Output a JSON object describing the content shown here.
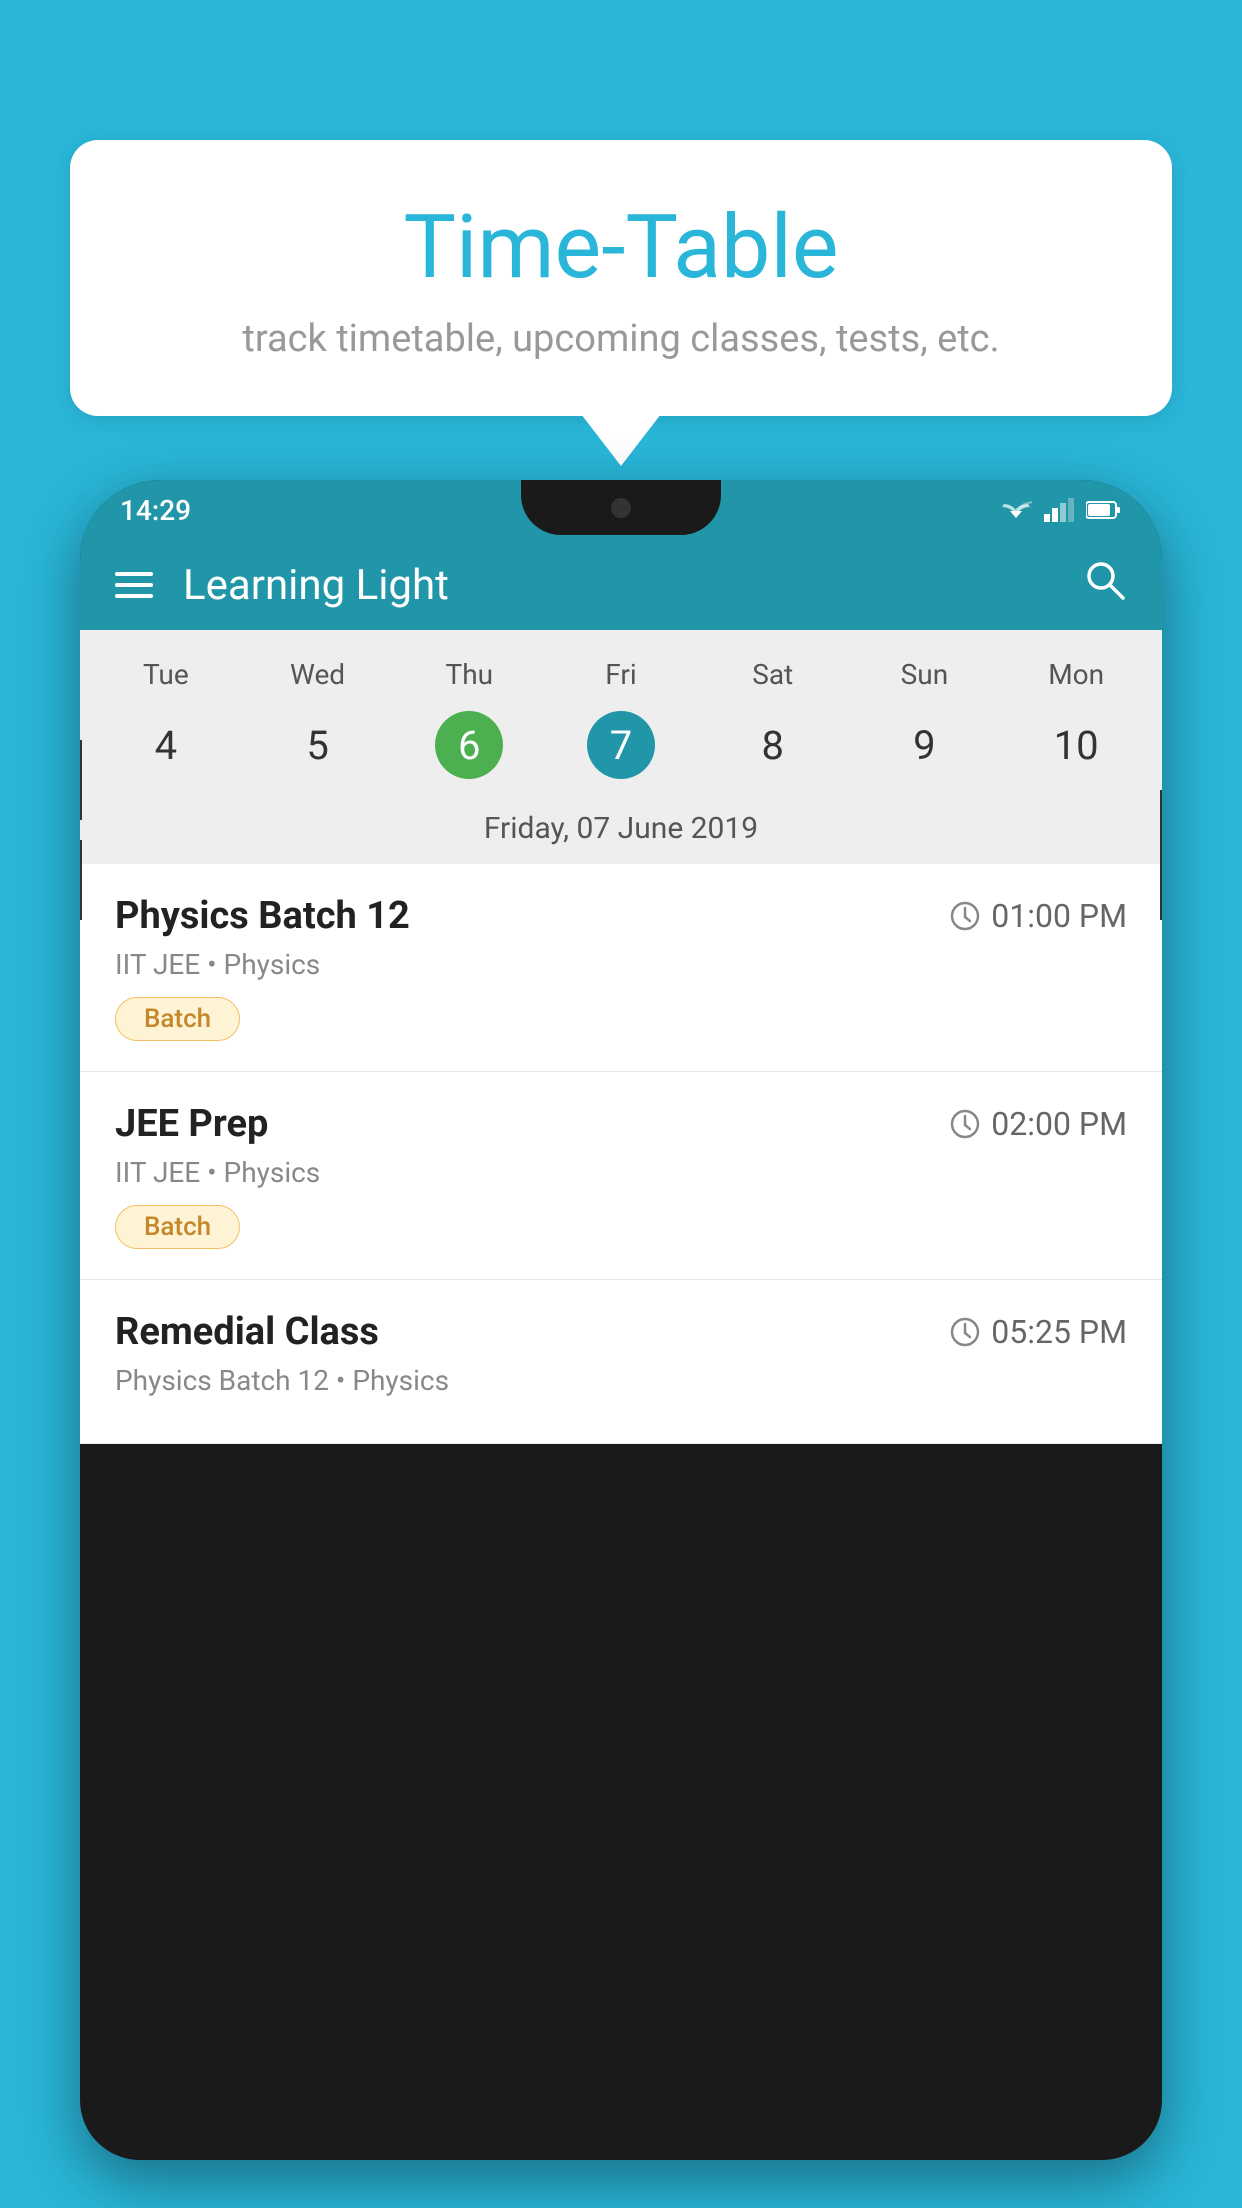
{
  "background_color": "#29b6d8",
  "bubble": {
    "title": "Time-Table",
    "subtitle": "track timetable, upcoming classes, tests, etc."
  },
  "phone": {
    "status_bar": {
      "time": "14:29"
    },
    "app_header": {
      "title": "Learning Light"
    },
    "calendar": {
      "days": [
        "Tue",
        "Wed",
        "Thu",
        "Fri",
        "Sat",
        "Sun",
        "Mon"
      ],
      "dates": [
        "4",
        "5",
        "6",
        "7",
        "8",
        "9",
        "10"
      ],
      "today_index": 2,
      "selected_index": 3,
      "selected_date_label": "Friday, 07 June 2019"
    },
    "classes": [
      {
        "name": "Physics Batch 12",
        "time": "01:00 PM",
        "meta": "IIT JEE • Physics",
        "badge": "Batch"
      },
      {
        "name": "JEE Prep",
        "time": "02:00 PM",
        "meta": "IIT JEE • Physics",
        "badge": "Batch"
      },
      {
        "name": "Remedial Class",
        "time": "05:25 PM",
        "meta": "Physics Batch 12 • Physics",
        "badge": ""
      }
    ]
  }
}
